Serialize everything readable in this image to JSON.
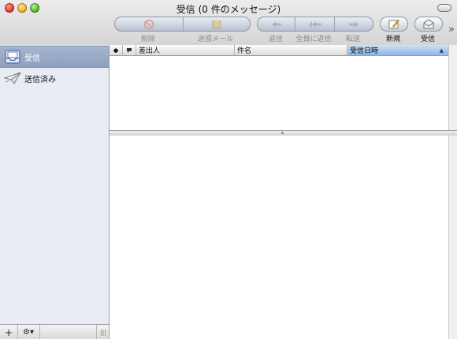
{
  "window": {
    "title": "受信 (0 件のメッセージ)"
  },
  "toolbar": {
    "delete_label": "削除",
    "junk_label": "迷惑メール",
    "reply_label": "返信",
    "reply_all_label": "全員に返信",
    "forward_label": "転送",
    "new_label": "新規",
    "get_mail_label": "受信",
    "overflow": "»"
  },
  "sidebar": {
    "items": [
      {
        "label": "受信",
        "icon": "inbox-icon",
        "selected": true
      },
      {
        "label": "送信済み",
        "icon": "sent-icon",
        "selected": false
      }
    ],
    "add_button": "+",
    "action_button": "⚙▾",
    "resize_grip": "|||"
  },
  "message_list": {
    "columns": [
      {
        "label": "●",
        "name": "read-status"
      },
      {
        "label": "",
        "name": "flag"
      },
      {
        "label": "差出人",
        "name": "from"
      },
      {
        "label": "件名",
        "name": "subject"
      },
      {
        "label": "受信日時",
        "name": "date-received",
        "sorted": true,
        "sort_indicator": "▲"
      }
    ],
    "rows": []
  },
  "colors": {
    "selection": "#8ea0bf",
    "sorted_header": "#8db5e6",
    "sidebar_bg": "#e8ecf4"
  }
}
